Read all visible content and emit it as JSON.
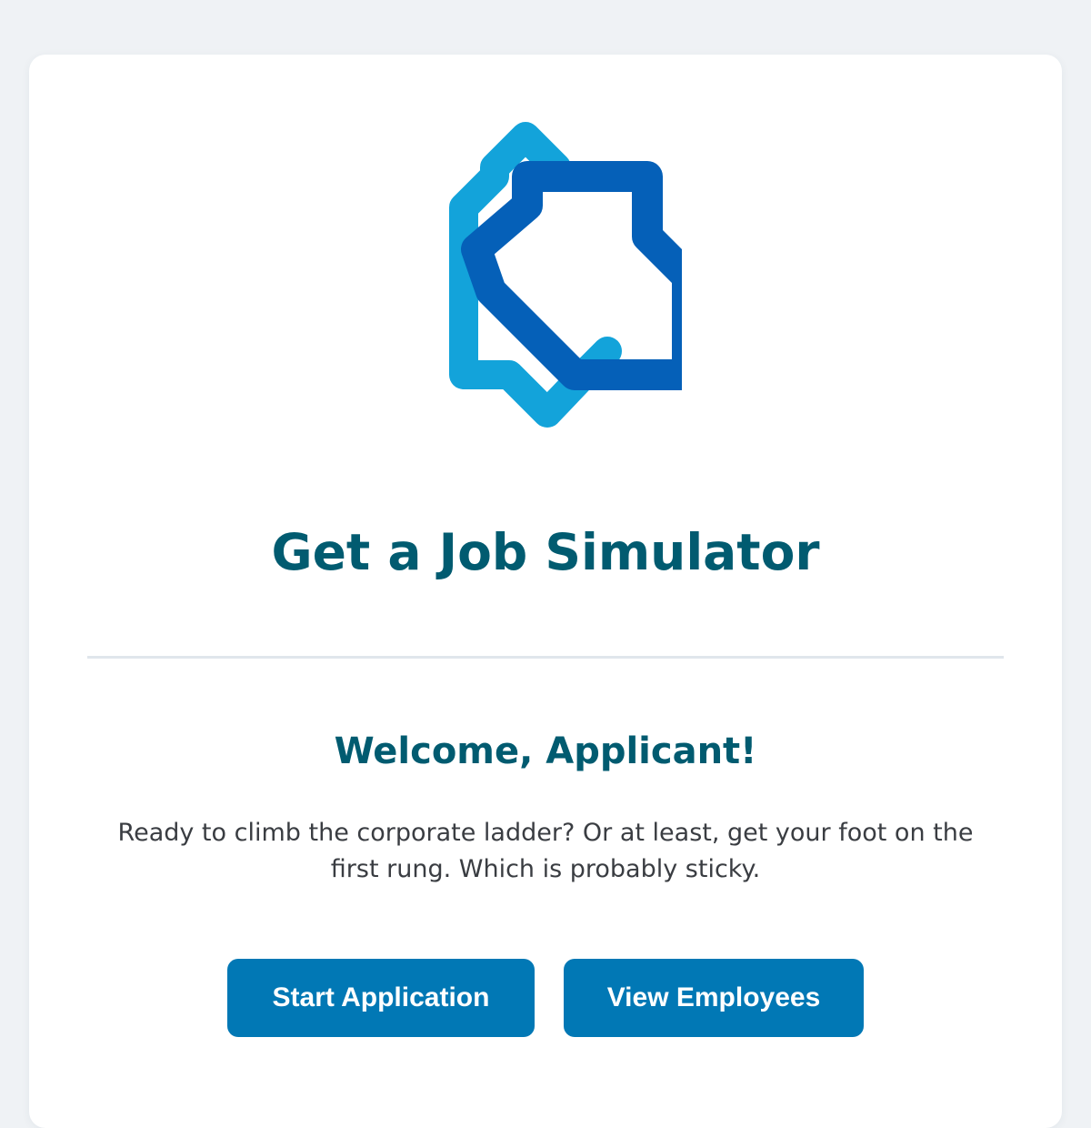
{
  "app": {
    "title": "Get a Job Simulator"
  },
  "welcome": {
    "heading": "Welcome, Applicant!",
    "description": "Ready to climb the corporate ladder? Or at least, get your foot on the first rung. Which is probably sticky."
  },
  "actions": {
    "start_label": "Start Application",
    "view_label": "View Employees"
  },
  "colors": {
    "background": "#eff2f5",
    "card": "#ffffff",
    "title": "#015b70",
    "button": "#0178b5",
    "logo_light": "#13a3da",
    "logo_dark": "#0560b8"
  },
  "icons": {
    "logo": "house-outline-logo-icon"
  }
}
